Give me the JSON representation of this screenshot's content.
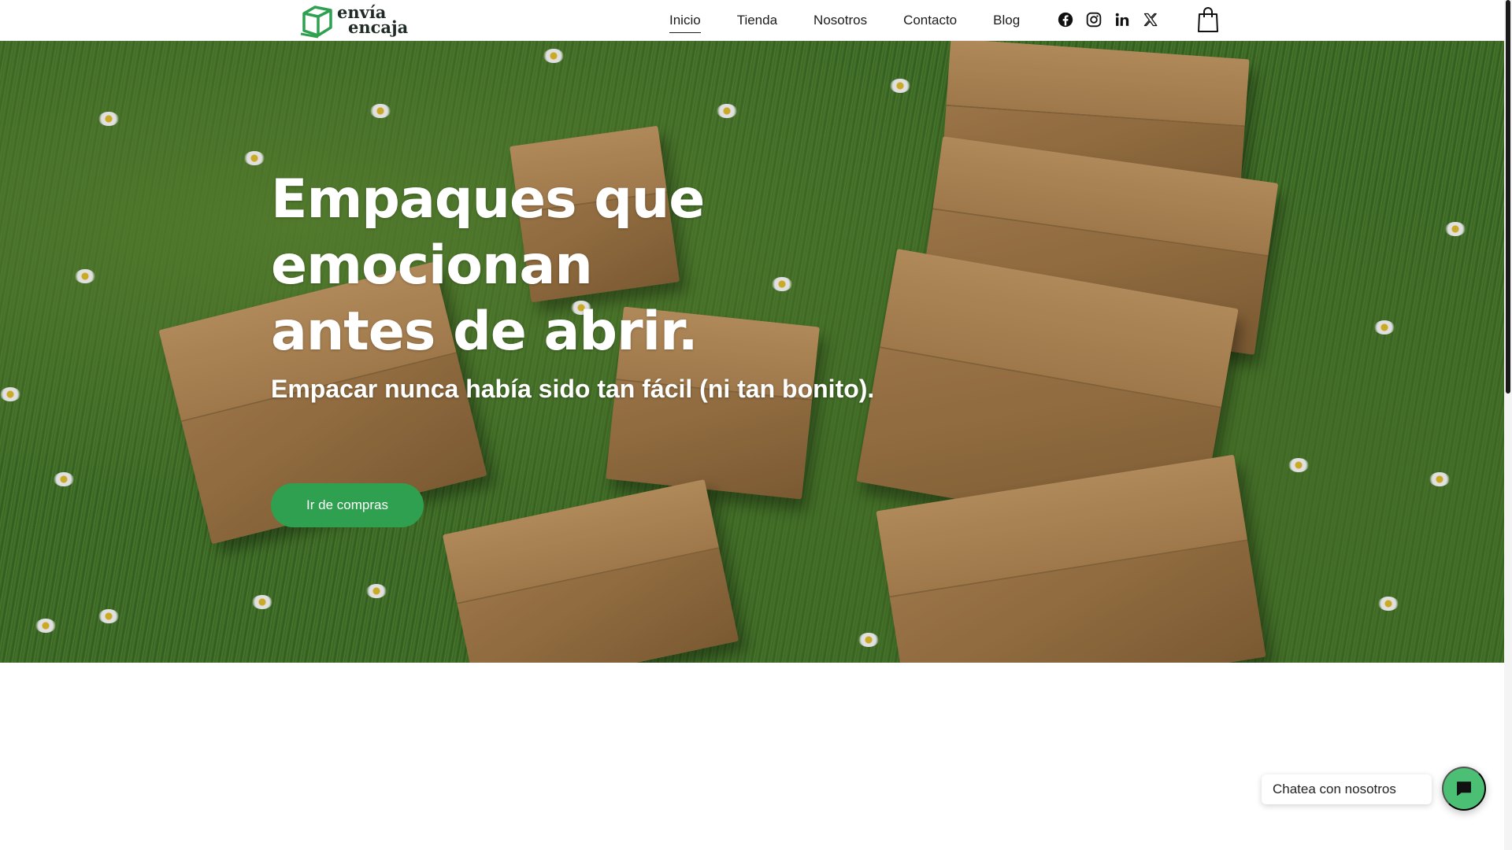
{
  "header": {
    "logo": {
      "line1": "envía",
      "line2": "encaja",
      "icon": "box-logo-icon",
      "color": "#2fa04f"
    },
    "nav": [
      {
        "label": "Inicio",
        "active": true
      },
      {
        "label": "Tienda",
        "active": false
      },
      {
        "label": "Nosotros",
        "active": false
      },
      {
        "label": "Contacto",
        "active": false
      },
      {
        "label": "Blog",
        "active": false
      }
    ],
    "social_icons": [
      "facebook-icon",
      "instagram-icon",
      "linkedin-icon",
      "x-icon"
    ],
    "cart_icon": "shopping-bag-icon"
  },
  "hero": {
    "title_line1": "Empaques que emocionan",
    "title_line2": "antes de abrir.",
    "subtitle": "Empacar nunca había sido tan fácil (ni tan bonito).",
    "button_label": "Ir de compras",
    "button_color": "#2fa04f"
  },
  "chat": {
    "label": "Chatea con nosotros",
    "icon": "chat-icon",
    "button_color": "#4bbf73"
  }
}
